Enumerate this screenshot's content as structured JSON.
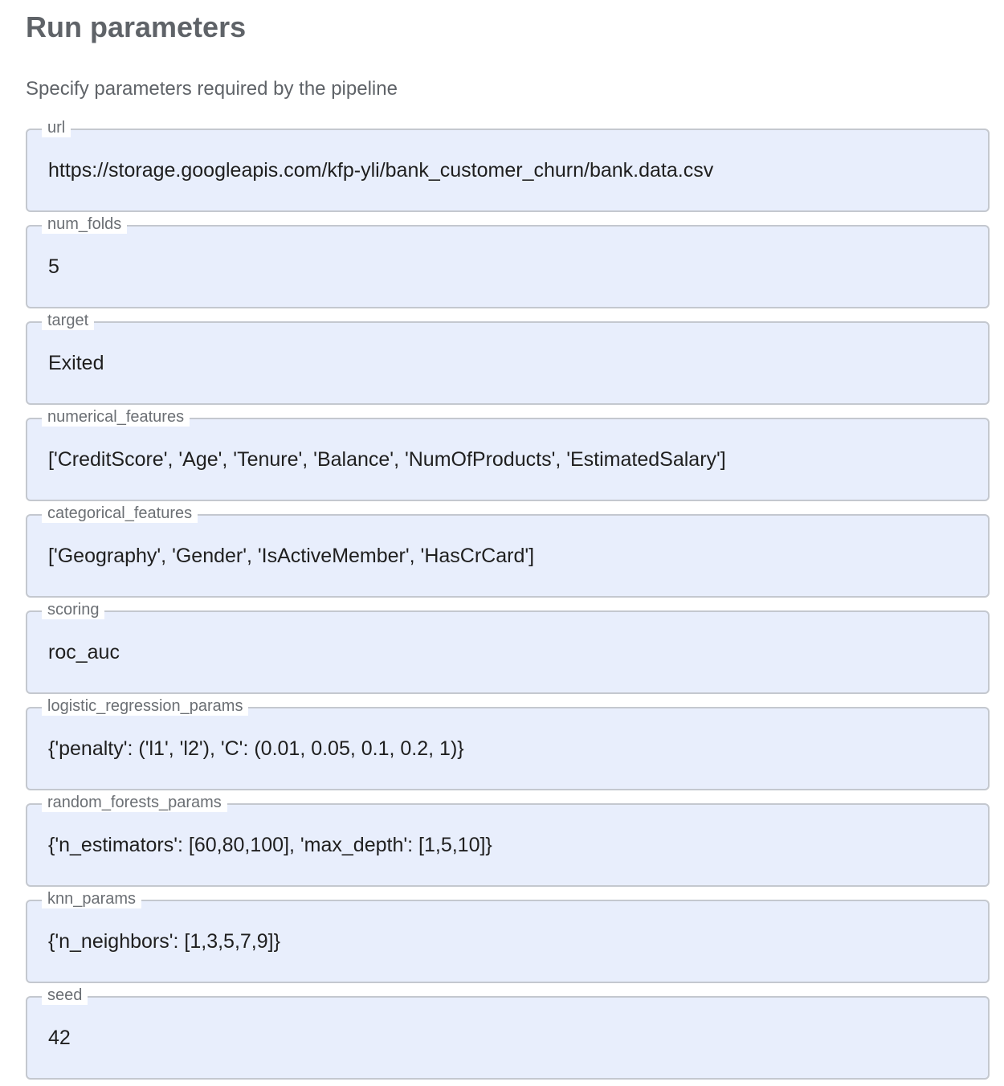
{
  "header": {
    "title": "Run parameters",
    "subtitle": "Specify parameters required by the pipeline"
  },
  "fields": [
    {
      "label": "url",
      "value": "https://storage.googleapis.com/kfp-yli/bank_customer_churn/bank.data.csv"
    },
    {
      "label": "num_folds",
      "value": "5"
    },
    {
      "label": "target",
      "value": "Exited"
    },
    {
      "label": "numerical_features",
      "value": "['CreditScore', 'Age', 'Tenure', 'Balance', 'NumOfProducts', 'EstimatedSalary']"
    },
    {
      "label": "categorical_features",
      "value": "['Geography', 'Gender', 'IsActiveMember', 'HasCrCard']"
    },
    {
      "label": "scoring",
      "value": "roc_auc"
    },
    {
      "label": "logistic_regression_params",
      "value": "{'penalty': ('l1', 'l2'), 'C': (0.01, 0.05, 0.1, 0.2, 1)}"
    },
    {
      "label": "random_forests_params",
      "value": "{'n_estimators': [60,80,100], 'max_depth': [1,5,10]}"
    },
    {
      "label": "knn_params",
      "value": "{'n_neighbors': [1,3,5,7,9]}"
    },
    {
      "label": "seed",
      "value": "42"
    }
  ],
  "colors": {
    "field_background": "#e8eefc",
    "field_border": "#c4c8cf",
    "heading_text": "#5f6368",
    "label_text": "#6b6f74"
  }
}
